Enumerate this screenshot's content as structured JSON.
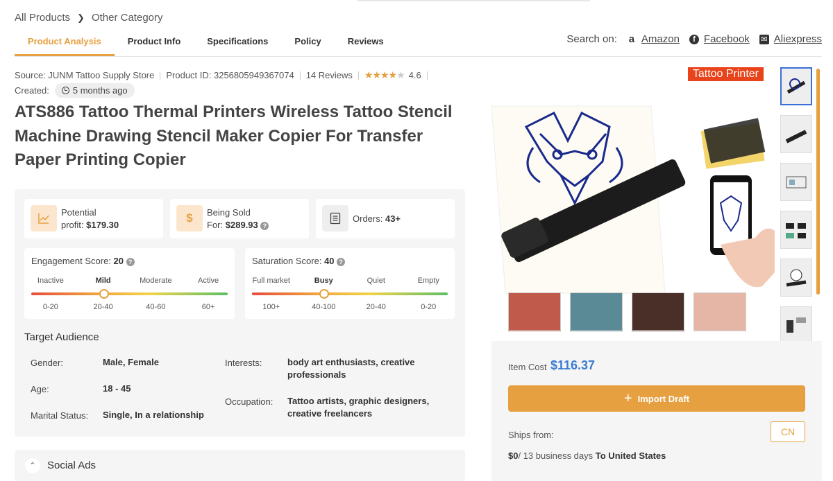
{
  "breadcrumb": {
    "root": "All Products",
    "current": "Other Category"
  },
  "tabs": [
    "Product Analysis",
    "Product Info",
    "Specifications",
    "Policy",
    "Reviews"
  ],
  "search_on": {
    "label": "Search on:",
    "sites": [
      "Amazon",
      "Facebook",
      "Aliexpress"
    ]
  },
  "meta": {
    "source": "Source: JUNM Tattoo Supply Store",
    "product_id": "Product ID: 3256805949367074",
    "reviews": "14 Reviews",
    "rating": "4.6",
    "stars_filled": 4,
    "created_label": "Created:",
    "created_value": "5 months ago"
  },
  "title": "ATS886 Tattoo Thermal Printers Wireless Tattoo Stencil Machine Drawing Stencil Maker Copier For Transfer Paper Printing Copier",
  "stats": {
    "potential_label": "Potential",
    "profit_label": "profit:",
    "profit_value": "$179.30",
    "sold_label": "Being Sold",
    "for_label": "For:",
    "sold_value": "$289.93",
    "orders_label": "Orders:",
    "orders_value": "43+"
  },
  "engagement": {
    "label": "Engagement Score:",
    "value": "20",
    "levels": [
      "Inactive",
      "Mild",
      "Moderate",
      "Active"
    ],
    "ranges": [
      "0-20",
      "20-40",
      "40-60",
      "60+"
    ],
    "active_index": 1,
    "position_pct": 37
  },
  "saturation": {
    "label": "Saturation Score:",
    "value": "40",
    "levels": [
      "Full market",
      "Busy",
      "Quiet",
      "Empty"
    ],
    "ranges": [
      "100+",
      "40-100",
      "20-40",
      "0-20"
    ],
    "active_index": 1,
    "position_pct": 37
  },
  "audience": {
    "title": "Target Audience",
    "gender_label": "Gender:",
    "gender_value": "Male, Female",
    "age_label": "Age:",
    "age_value": "18 - 45",
    "marital_label": "Marital Status:",
    "marital_value": "Single, In a relationship",
    "interests_label": "Interests:",
    "interests_value": "body art enthusiasts, creative professionals",
    "occupation_label": "Occupation:",
    "occupation_value": "Tattoo artists, graphic designers, creative freelancers"
  },
  "social_ads": "Social Ads",
  "image": {
    "badge": "Tattoo Printer"
  },
  "purchase": {
    "item_cost_label": "Item Cost",
    "item_cost_value": "$116.37",
    "import_label": "Import Draft",
    "ships_from_label": "Ships from:",
    "country": "CN",
    "shipping_cost": "$0",
    "shipping_days": "/ 13 business days",
    "shipping_dest": "To United States"
  },
  "colors": {
    "accent": "#e6a040",
    "link_blue": "#3a7bd5",
    "badge_red": "#e8431a"
  }
}
